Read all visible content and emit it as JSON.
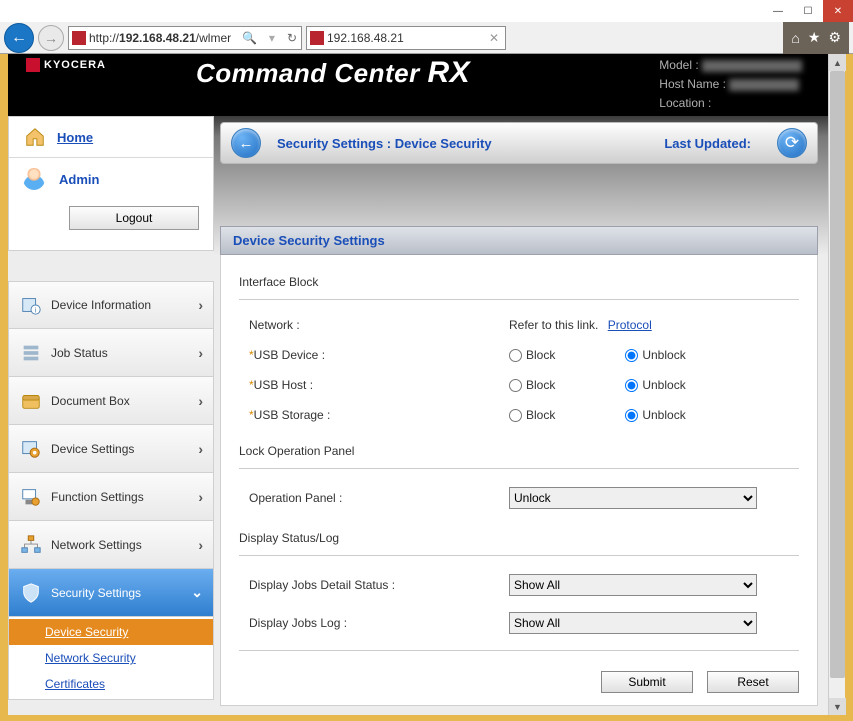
{
  "window": {
    "address_url": "http://192.168.48.21/wlmer",
    "address_ip_segment": "192.168.48.21",
    "tab_title": "192.168.48.21"
  },
  "header": {
    "brand_small": "KYOCERA",
    "brand_title": "Command Center RX",
    "model_label": "Model :",
    "hostname_label": "Host Name :",
    "location_label": "Location :"
  },
  "sidebar": {
    "home_label": "Home",
    "admin_label": "Admin",
    "logout_label": "Logout",
    "items": [
      {
        "label": "Device Information"
      },
      {
        "label": "Job Status"
      },
      {
        "label": "Document Box"
      },
      {
        "label": "Device Settings"
      },
      {
        "label": "Function Settings"
      },
      {
        "label": "Network Settings"
      },
      {
        "label": "Security Settings"
      }
    ],
    "sub_items": [
      {
        "label": "Device Security",
        "active": true
      },
      {
        "label": "Network Security"
      },
      {
        "label": "Certificates"
      }
    ]
  },
  "crumb": {
    "text": "Security Settings : Device Security",
    "last_updated_label": "Last Updated:"
  },
  "panel": {
    "title": "Device Security Settings",
    "section_interface": "Interface Block",
    "network_label": "Network :",
    "network_refer": "Refer to this link.",
    "network_link": "Protocol",
    "usb_device_label": "USB Device :",
    "usb_host_label": "USB Host :",
    "usb_storage_label": "USB Storage :",
    "radio_block": "Block",
    "radio_unblock": "Unblock",
    "section_lock": "Lock Operation Panel",
    "op_panel_label": "Operation Panel :",
    "op_select": "Unlock",
    "section_display": "Display Status/Log",
    "disp_detail_label": "Display Jobs Detail Status :",
    "disp_detail_select": "Show All",
    "disp_log_label": "Display Jobs Log :",
    "disp_log_select": "Show All",
    "submit_label": "Submit",
    "reset_label": "Reset"
  }
}
